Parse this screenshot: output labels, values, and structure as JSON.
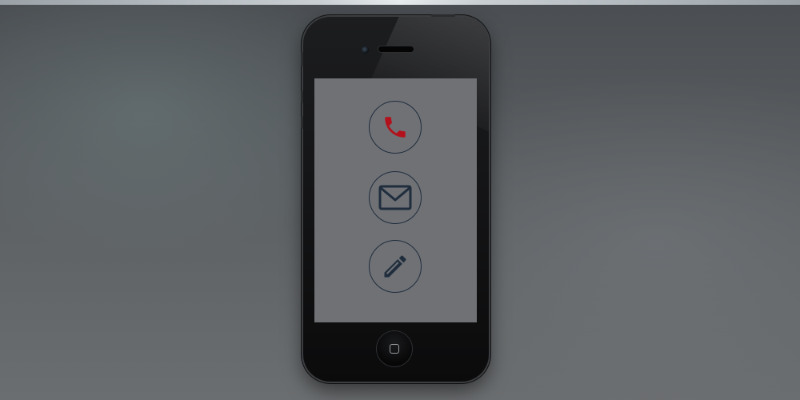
{
  "device": {
    "model": "smartphone",
    "screen_color": "#6f7175"
  },
  "actions": [
    {
      "id": "call",
      "icon": "phone-icon",
      "color": "#b3121c"
    },
    {
      "id": "mail",
      "icon": "envelope-icon",
      "color": "#1f2d3d"
    },
    {
      "id": "edit",
      "icon": "pencil-icon",
      "color": "#1f2d3d"
    }
  ],
  "colors": {
    "ring": "#1f2d3d",
    "phone_accent": "#b3121c",
    "icon_navy": "#1f2d3d"
  }
}
